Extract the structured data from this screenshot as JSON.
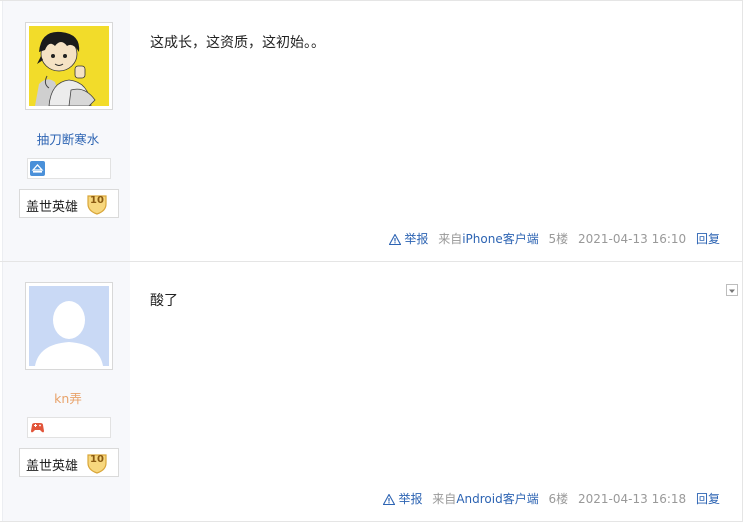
{
  "posts": [
    {
      "user": {
        "name": "抽刀断寒水",
        "level_title": "盖世英雄",
        "level": "10"
      },
      "text": "这成长，这资质，这初始。。",
      "tail": {
        "report": "举报",
        "from_prefix": "来自",
        "client": "iPhone客户端",
        "floor": "5楼",
        "time": "2021-04-13 16:10",
        "reply": "回复"
      }
    },
    {
      "user": {
        "name": "kn弄",
        "level_title": "盖世英雄",
        "level": "10"
      },
      "text": "酸了",
      "tail": {
        "report": "举报",
        "from_prefix": "来自",
        "client": "Android客户端",
        "floor": "6楼",
        "time": "2021-04-13 16:18",
        "reply": "回复"
      }
    }
  ],
  "colors": {
    "link": "#2d64b3",
    "username_orange": "#e8a36b",
    "meta_gray": "#999999",
    "sidebar_bg": "#f7f8fb"
  },
  "icons": [
    "report-warning-icon",
    "member-badge-icon",
    "game-controller-icon",
    "level-shield-icon",
    "dropdown-arrow-icon"
  ]
}
